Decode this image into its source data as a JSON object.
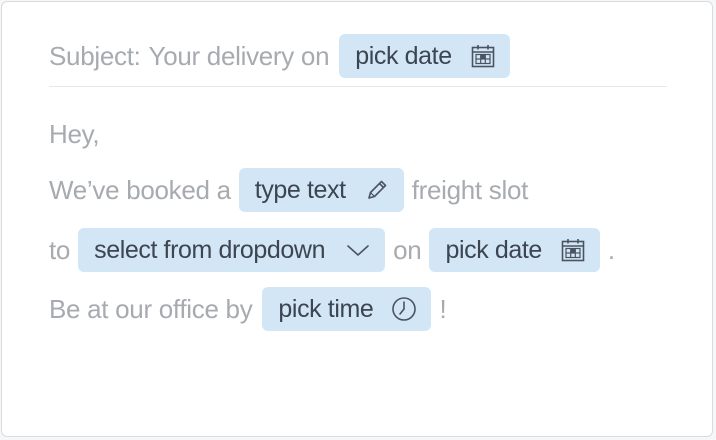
{
  "subject": {
    "prefix": "Subject:",
    "text": "Your delivery on",
    "chip_label": "pick date",
    "chip_icon": "calendar-icon"
  },
  "greeting": "Hey,",
  "line2": {
    "before": "We’ve booked a",
    "chip_label": "type text",
    "chip_icon": "pencil-icon",
    "after": "freight slot"
  },
  "line3": {
    "before": "to",
    "dropdown_label": "select from dropdown",
    "dropdown_icon": "chevron-down-icon",
    "middle": "on",
    "date_label": "pick date",
    "date_icon": "calendar-icon",
    "after": "."
  },
  "line4": {
    "before": "Be at our office by",
    "chip_label": "pick time",
    "chip_icon": "clock-icon",
    "after": "!"
  },
  "colors": {
    "chip_bg": "#d3e6f6",
    "chip_text": "#3c4550",
    "body_text": "#a7abb0",
    "divider": "#e6e8ea"
  }
}
